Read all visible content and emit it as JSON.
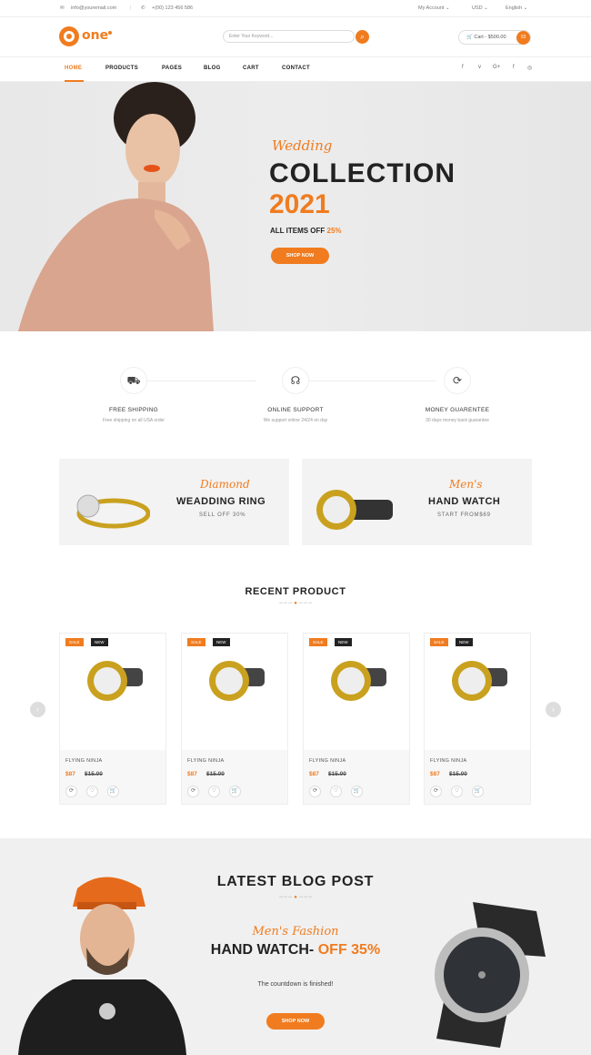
{
  "topbar": {
    "email": "info@youremail.com",
    "phone": "+(00) 123 456 586",
    "account": "My Account",
    "currency": "USD",
    "language": "English"
  },
  "header": {
    "logo_text": "one",
    "search_placeholder": "Enter Your Keyword...",
    "cart_label": "Cart - $500.00",
    "cart_count": "03"
  },
  "nav": {
    "items": [
      "HOME",
      "PRODUCTS",
      "PAGES",
      "BLOG",
      "CART",
      "CONTACT"
    ],
    "social": [
      "f",
      "v",
      "G+",
      "f",
      "◎"
    ]
  },
  "hero": {
    "script": "Wedding",
    "title": "COLLECTION",
    "year": "2021",
    "subtitle_prefix": "ALL ITEMS OFF",
    "subtitle_value": "25%",
    "button": "SHOP NOW"
  },
  "features": [
    {
      "title": "FREE SHIPPING",
      "sub": "Free shipping on all USA order",
      "icon": "truck-icon"
    },
    {
      "title": "ONLINE SUPPORT",
      "sub": "We support online 24/24 on day",
      "icon": "headset-icon"
    },
    {
      "title": "MONEY GUARENTEE",
      "sub": "30 days money back guarantee",
      "icon": "refresh-icon"
    }
  ],
  "banners": [
    {
      "script": "Diamond",
      "title": "WEADDING RING",
      "sub": "SELL OFF 30%"
    },
    {
      "script": "Men's",
      "title": "HAND WATCH",
      "sub": "START FROM$69"
    }
  ],
  "recent": {
    "heading": "RECENT PRODUCT",
    "products": [
      {
        "sale": "SALE",
        "new": "NEW",
        "name": "FLYING NINJA",
        "price": "$87",
        "old": "$15.00"
      },
      {
        "sale": "SALE",
        "new": "NEW",
        "name": "FLYING NINJA",
        "price": "$87",
        "old": "$15.00"
      },
      {
        "sale": "SALE",
        "new": "NEW",
        "name": "FLYING NINJA",
        "price": "$87",
        "old": "$15.00"
      },
      {
        "sale": "SALE",
        "new": "NEW",
        "name": "FLYING NINJA",
        "price": "$87",
        "old": "$15.00"
      }
    ]
  },
  "blog": {
    "heading": "LATEST BLOG POST",
    "script": "Men's Fashion",
    "title_prefix": "HAND WATCH-",
    "title_accent": "OFF 35%",
    "countdown": "The countdown is finished!",
    "button": "SHOP NOW"
  },
  "colors": {
    "accent": "#f07c1f"
  }
}
